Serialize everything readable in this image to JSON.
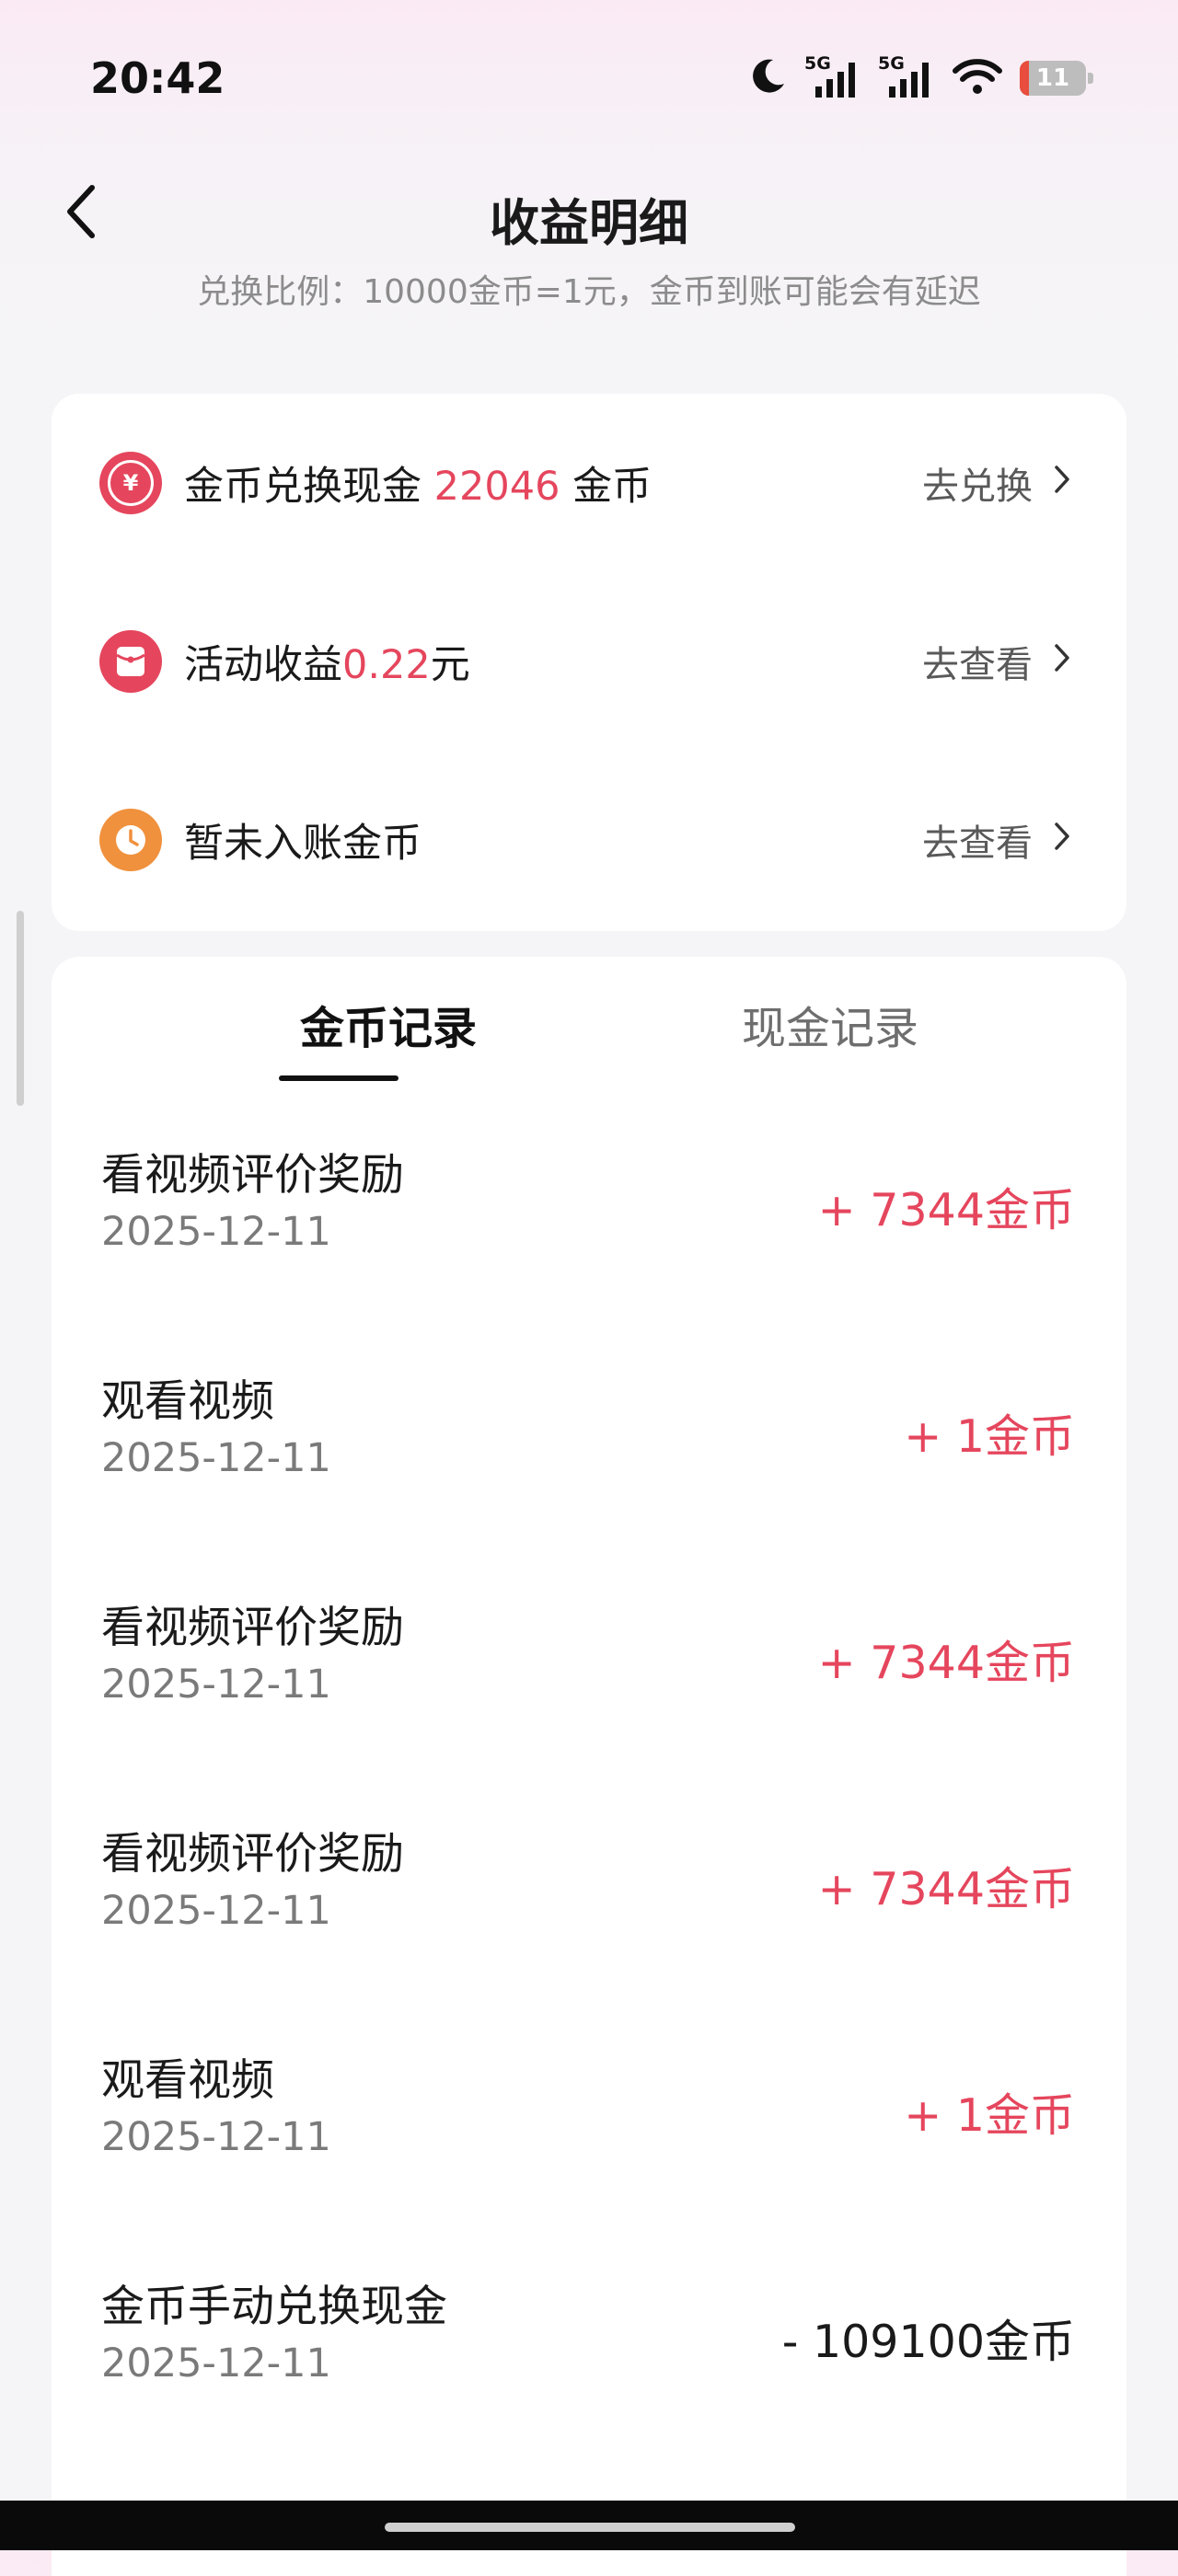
{
  "status_bar": {
    "time": "20:42",
    "network_labels": [
      "5G",
      "5G"
    ],
    "battery_level": "11",
    "icons": [
      "moon-icon",
      "signal-icon",
      "signal-icon",
      "wifi-icon",
      "battery-icon"
    ]
  },
  "header": {
    "title": "收益明细",
    "subtitle": "兑换比例：10000金币=1元，金币到账可能会有延迟"
  },
  "summary": {
    "exchange": {
      "label_pre": "金币兑换现金 ",
      "value": "22046",
      "label_post": " 金币",
      "action": "去兑换",
      "icon_glyph": "¥",
      "icon": "yen-coin-icon",
      "color": "#e5465d"
    },
    "activity": {
      "label_pre": "活动收益",
      "value": "0.22",
      "label_post": "元",
      "action": "去查看",
      "icon": "red-envelope-icon",
      "color": "#e5465d"
    },
    "pending": {
      "label": "暂未入账金币",
      "action": "去查看",
      "icon": "clock-icon",
      "color": "#f0913d"
    }
  },
  "tabs": [
    {
      "label": "金币记录",
      "active": true
    },
    {
      "label": "现金记录",
      "active": false
    }
  ],
  "records": [
    {
      "title": "看视频评价奖励",
      "date": "2025-12-11",
      "amount": "+ 7344金币"
    },
    {
      "title": "观看视频",
      "date": "2025-12-11",
      "amount": "+ 1金币"
    },
    {
      "title": "看视频评价奖励",
      "date": "2025-12-11",
      "amount": "+ 7344金币"
    },
    {
      "title": "看视频评价奖励",
      "date": "2025-12-11",
      "amount": "+ 7344金币"
    },
    {
      "title": "观看视频",
      "date": "2025-12-11",
      "amount": "+ 1金币"
    },
    {
      "title": "金币手动兑换现金",
      "date": "2025-12-11",
      "amount": "- 109100金币"
    }
  ],
  "colors": {
    "accent": "#e5465d",
    "orange": "#f0913d",
    "background": "#f5f5f7"
  }
}
